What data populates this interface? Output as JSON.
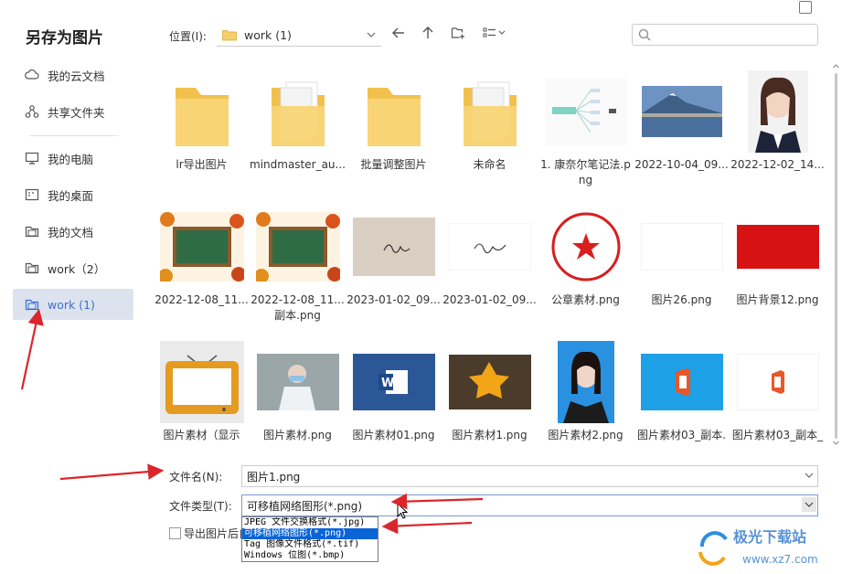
{
  "dialog": {
    "title": "另存为图片"
  },
  "sidebar": {
    "items": [
      {
        "label": "我的云文档",
        "icon": "cloud-icon"
      },
      {
        "label": "共享文件夹",
        "icon": "share-icon"
      },
      {
        "label": "我的电脑",
        "icon": "computer-icon"
      },
      {
        "label": "我的桌面",
        "icon": "desktop-icon"
      },
      {
        "label": "我的文档",
        "icon": "folder-icon"
      },
      {
        "label": "work（2）",
        "icon": "folder-icon"
      },
      {
        "label": "work (1)",
        "icon": "folder-icon"
      }
    ],
    "active_index": 6
  },
  "toolbar": {
    "location_label": "位置(I):",
    "location_value": "work (1)"
  },
  "files": [
    {
      "name": "lr导出图片",
      "type": "folder"
    },
    {
      "name": "mindmaster_au...",
      "type": "folder-docs"
    },
    {
      "name": "批量调整图片",
      "type": "folder"
    },
    {
      "name": "未命名",
      "type": "folder-docs"
    },
    {
      "name": "1. 康奈尔笔记法.png",
      "type": "mindmap"
    },
    {
      "name": "2022-10-04_09...",
      "type": "landscape"
    },
    {
      "name": "2022-12-02_14...",
      "type": "portrait"
    },
    {
      "name": "2022-12-08_11...",
      "type": "chalkboard"
    },
    {
      "name": "2022-12-08_11...副本.png",
      "type": "chalkboard"
    },
    {
      "name": "2023-01-02_09...",
      "type": "signature1"
    },
    {
      "name": "2023-01-02_09...",
      "type": "signature2"
    },
    {
      "name": "公章素材.png",
      "type": "seal"
    },
    {
      "name": "图片26.png",
      "type": "blank"
    },
    {
      "name": "图片背景12.png",
      "type": "red"
    },
    {
      "name": "图片素材（显示",
      "type": "tv"
    },
    {
      "name": "图片素材.png",
      "type": "doctor"
    },
    {
      "name": "图片素材01.png",
      "type": "word"
    },
    {
      "name": "图片素材1.png",
      "type": "leaf"
    },
    {
      "name": "图片素材2.png",
      "type": "portrait2"
    },
    {
      "name": "图片素材03_副本.",
      "type": "office-blue"
    },
    {
      "name": "图片素材03_副本_",
      "type": "office-white"
    }
  ],
  "form": {
    "filename_label": "文件名(N):",
    "filename_value": "图片1.png",
    "filetype_label": "文件类型(T):",
    "filetype_value": "可移植网络图形(*.png)",
    "filetype_options": [
      "JPEG 文件交换格式(*.jpg)",
      "可移植网络图形(*.png)",
      "Tag 图像文件格式(*.tif)",
      "Windows 位图(*.bmp)"
    ],
    "selected_option_index": 1,
    "checkbox_label": "导出图片后自动打开"
  },
  "watermark": {
    "brand": "极光下载站",
    "url": "www.xz7.com"
  },
  "colors": {
    "accent": "#3d6fcf",
    "selection": "#0a64d6",
    "folder": "#f6cf6a",
    "arrow": "#d9262c"
  }
}
